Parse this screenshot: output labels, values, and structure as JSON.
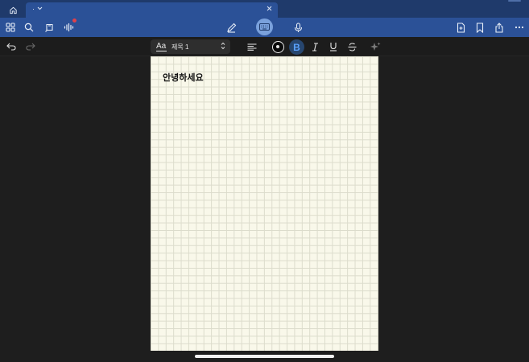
{
  "tabs": {
    "home_icon": "home-icon",
    "document_tab_title": "·"
  },
  "toolbar": {
    "left_icons": [
      "grid-icon",
      "search-icon",
      "lasso-icon",
      "voice-wave-icon"
    ],
    "center_icons": [
      "pen-icon",
      "keyboard-icon",
      "microphone-icon"
    ],
    "right_icons": [
      "new-page-icon",
      "bookmark-icon",
      "share-icon",
      "more-icon"
    ],
    "recording_dot_color": "#e0414a",
    "active_color": "#7aa1dc"
  },
  "format_bar": {
    "style_preview": "Aa",
    "style_name": "제목 1",
    "bold_label": "B",
    "bold_active_color": "#5aa2ff",
    "text_color": "#0a0a0a"
  },
  "page": {
    "text": "안녕하세요",
    "paper_style": "grid",
    "paper_color": "#f9f8ea"
  },
  "colors": {
    "tabbar_bg": "#1f3a6b",
    "toolbar_bg": "#2b5197",
    "canvas_bg": "#1e1e1e"
  }
}
